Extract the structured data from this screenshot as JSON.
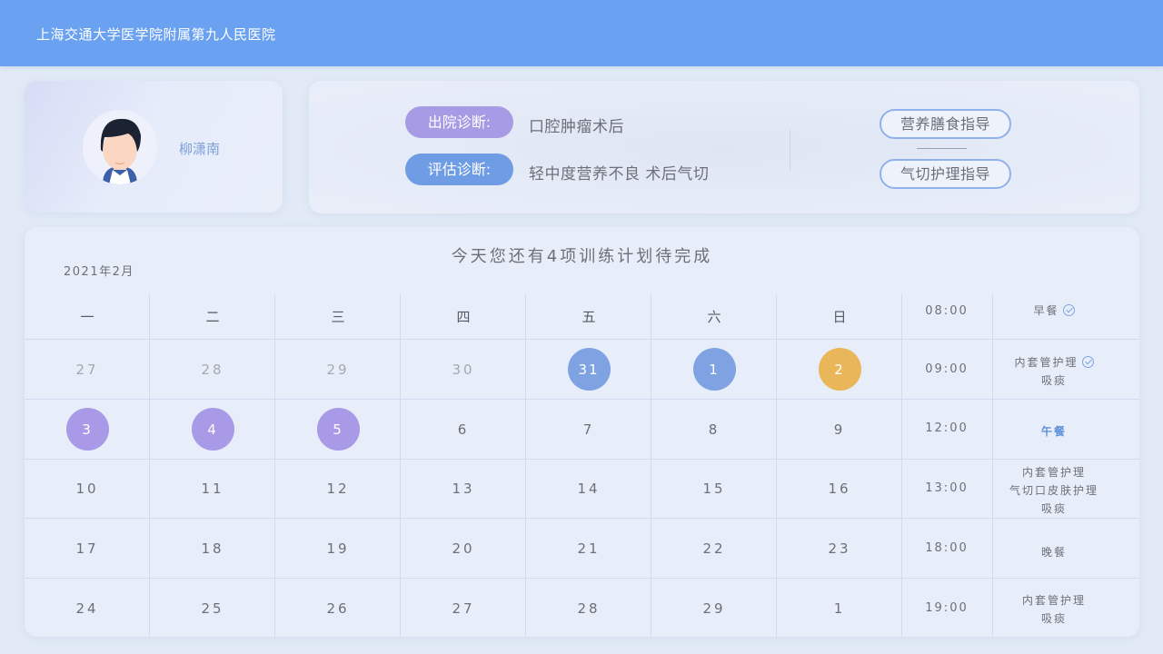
{
  "header": {
    "title": "上海交通大学医学院附属第九人民医院"
  },
  "patient": {
    "name": "柳潇南"
  },
  "diagnosis": {
    "discharge_label": "出院诊断:",
    "discharge_value": "口腔肿瘤术后",
    "assessment_label": "评估诊断:",
    "assessment_value": "轻中度营养不良 术后气切"
  },
  "guides": {
    "nutrition": "营养膳食指导",
    "tracheostomy": "气切护理指导"
  },
  "calendar": {
    "headline": "今天您还有4项训练计划待完成",
    "month": "2021年2月",
    "weekdays": [
      "一",
      "二",
      "三",
      "四",
      "五",
      "六",
      "日"
    ],
    "rows": [
      [
        "27",
        "28",
        "29",
        "30",
        "31",
        "1",
        "2"
      ],
      [
        "3",
        "4",
        "5",
        "6",
        "7",
        "8",
        "9"
      ],
      [
        "10",
        "11",
        "12",
        "13",
        "14",
        "15",
        "16"
      ],
      [
        "17",
        "18",
        "19",
        "20",
        "21",
        "22",
        "23"
      ],
      [
        "24",
        "25",
        "26",
        "27",
        "28",
        "29",
        "1"
      ]
    ],
    "colors": {
      "blue": "#7fa3e2",
      "gold": "#e9b75a",
      "purple": "#a89ae6"
    }
  },
  "schedule": [
    {
      "time": "08:00",
      "tasks": [
        "早餐"
      ],
      "done": true
    },
    {
      "time": "09:00",
      "tasks": [
        "内套管护理",
        "吸痰"
      ],
      "done": true
    },
    {
      "time": "12:00",
      "tasks": [
        "午餐"
      ],
      "highlight": true
    },
    {
      "time": "13:00",
      "tasks": [
        "内套管护理",
        "气切口皮肤护理",
        "吸痰"
      ]
    },
    {
      "time": "18:00",
      "tasks": [
        "晚餐"
      ]
    },
    {
      "time": "19:00",
      "tasks": [
        "内套管护理",
        "吸痰"
      ]
    }
  ]
}
